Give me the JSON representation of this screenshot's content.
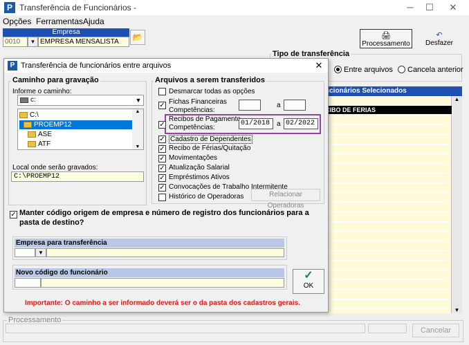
{
  "window": {
    "title": "Transferência de Funcionários -",
    "app_icon": "P",
    "minimize": "─",
    "maximize": "☐",
    "close": "✕"
  },
  "menu": [
    "Opções",
    "Ferramentas",
    "Ajuda"
  ],
  "empresa": {
    "header": "Empresa",
    "code": "0010",
    "name": "EMPRESA MENSALISTA"
  },
  "toolbar": {
    "processamento": "Processamento",
    "desfazer": "Desfazer"
  },
  "tipo_transferencia": {
    "title": "Tipo de transferência",
    "options": [
      "Entre arquivos",
      "Cancela anterior"
    ],
    "selected": "Entre arquivos"
  },
  "selecionados": {
    "header": "ncionários Selecionados",
    "row1": "CIBO DE FERIAS"
  },
  "processamento_panel": {
    "label": "Processamento",
    "cancel": "Cancelar"
  },
  "dialog": {
    "title": "Transferência de funcionários entre arquivos",
    "app_icon": "P",
    "close": "✕",
    "caminho": {
      "title": "Caminho para gravação",
      "informe_label": "Informe o caminho:",
      "drive": "c:",
      "folders": [
        "C:\\",
        "PROEMP12",
        "ASE",
        "ATF"
      ],
      "selected_folder": "PROEMP12",
      "local_label": "Local onde serão gravados:",
      "local_path": "C:\\PROEMP12"
    },
    "arquivos": {
      "title": "Arquivos a serem transferidos",
      "desmarcar": "Desmarcar todas as opções",
      "fichas_line1": "Fichas Financeiras",
      "fichas_line2": "Competências:",
      "recibos_line1": "Recibos de Pagamento",
      "recibos_line2": "Competências:",
      "recibos_from": "01/2018",
      "recibos_to": "02/2022",
      "a": "a",
      "items": [
        {
          "label": "Cadastro de Dependentes",
          "checked": true
        },
        {
          "label": "Recibo de Férias/Quitação",
          "checked": true
        },
        {
          "label": "Movimentações",
          "checked": true
        },
        {
          "label": "Atualização Salarial",
          "checked": true
        },
        {
          "label": "Empréstimos Ativos",
          "checked": true
        },
        {
          "label": "Convocações de Trabalho Intermitente",
          "checked": true
        },
        {
          "label": "Histórico de Operadoras",
          "checked": false
        }
      ],
      "relacionar": "Relacionar Operadoras"
    },
    "manter": "Manter código origem de empresa e número de registro dos funcionários para a pasta de destino?",
    "empresa_transferencia": "Empresa para transferência",
    "novo_codigo": "Novo código do funcionário",
    "ok": "OK",
    "importante": "Importante: O caminho a ser informado deverá ser o da pasta dos cadastros gerais."
  }
}
